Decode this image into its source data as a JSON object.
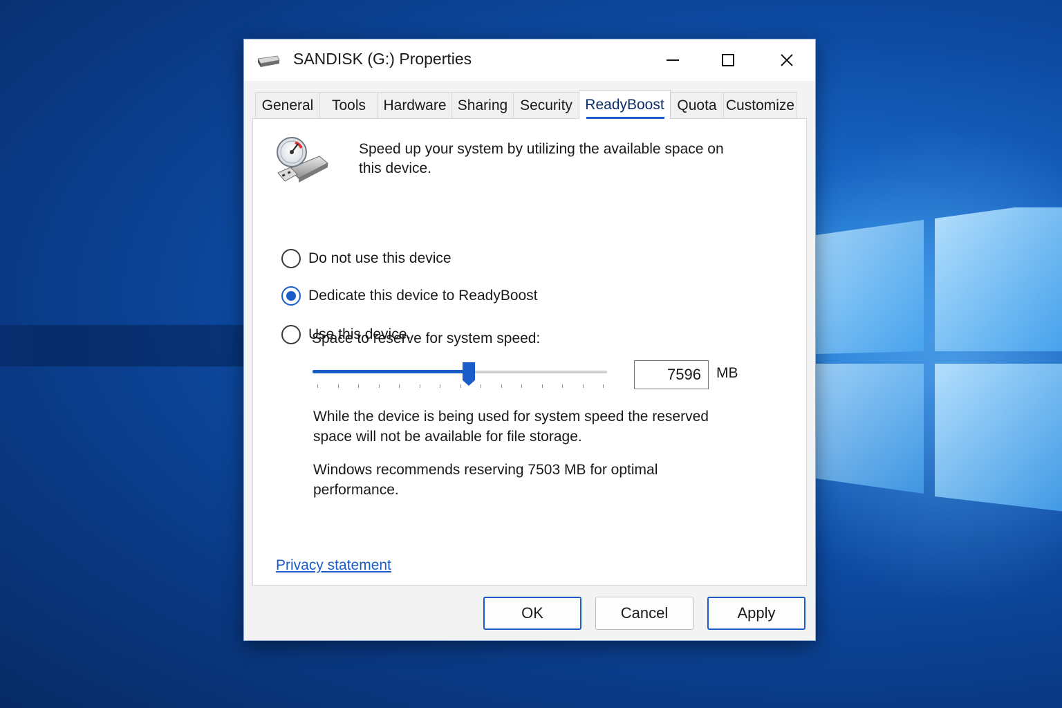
{
  "window": {
    "title": "SANDISK (G:) Properties",
    "controls": {
      "minimize": "minimize-icon",
      "maximize": "maximize-icon",
      "close": "close-icon"
    }
  },
  "tabs": [
    {
      "label": "General",
      "active": false
    },
    {
      "label": "Tools",
      "active": false
    },
    {
      "label": "Hardware",
      "active": false
    },
    {
      "label": "Sharing",
      "active": false
    },
    {
      "label": "Security",
      "active": false
    },
    {
      "label": "ReadyBoost",
      "active": true
    },
    {
      "label": "Quota",
      "active": false
    },
    {
      "label": "Customize",
      "active": false
    }
  ],
  "readyboost": {
    "intro": "Speed up your system by utilizing the available space on this device.",
    "options": [
      {
        "label": "Do not use this device",
        "checked": false
      },
      {
        "label": "Dedicate this device to ReadyBoost",
        "checked": true
      },
      {
        "label": "Use this device.",
        "checked": false
      }
    ],
    "reserve_label": "Space to reserve for system speed:",
    "slider_level": 0.53,
    "reserve_value": "7596",
    "reserve_unit": "MB",
    "note_storage": "While the device is being used for system speed the reserved space will not be available for file storage.",
    "note_recommend": "Windows recommends reserving 7503 MB for optimal performance.",
    "privacy_link": "Privacy statement"
  },
  "buttons": {
    "ok": "OK",
    "cancel": "Cancel",
    "apply": "Apply"
  },
  "colors": {
    "accent": "#1a5dc8",
    "desktop": "#0d4ba3"
  }
}
